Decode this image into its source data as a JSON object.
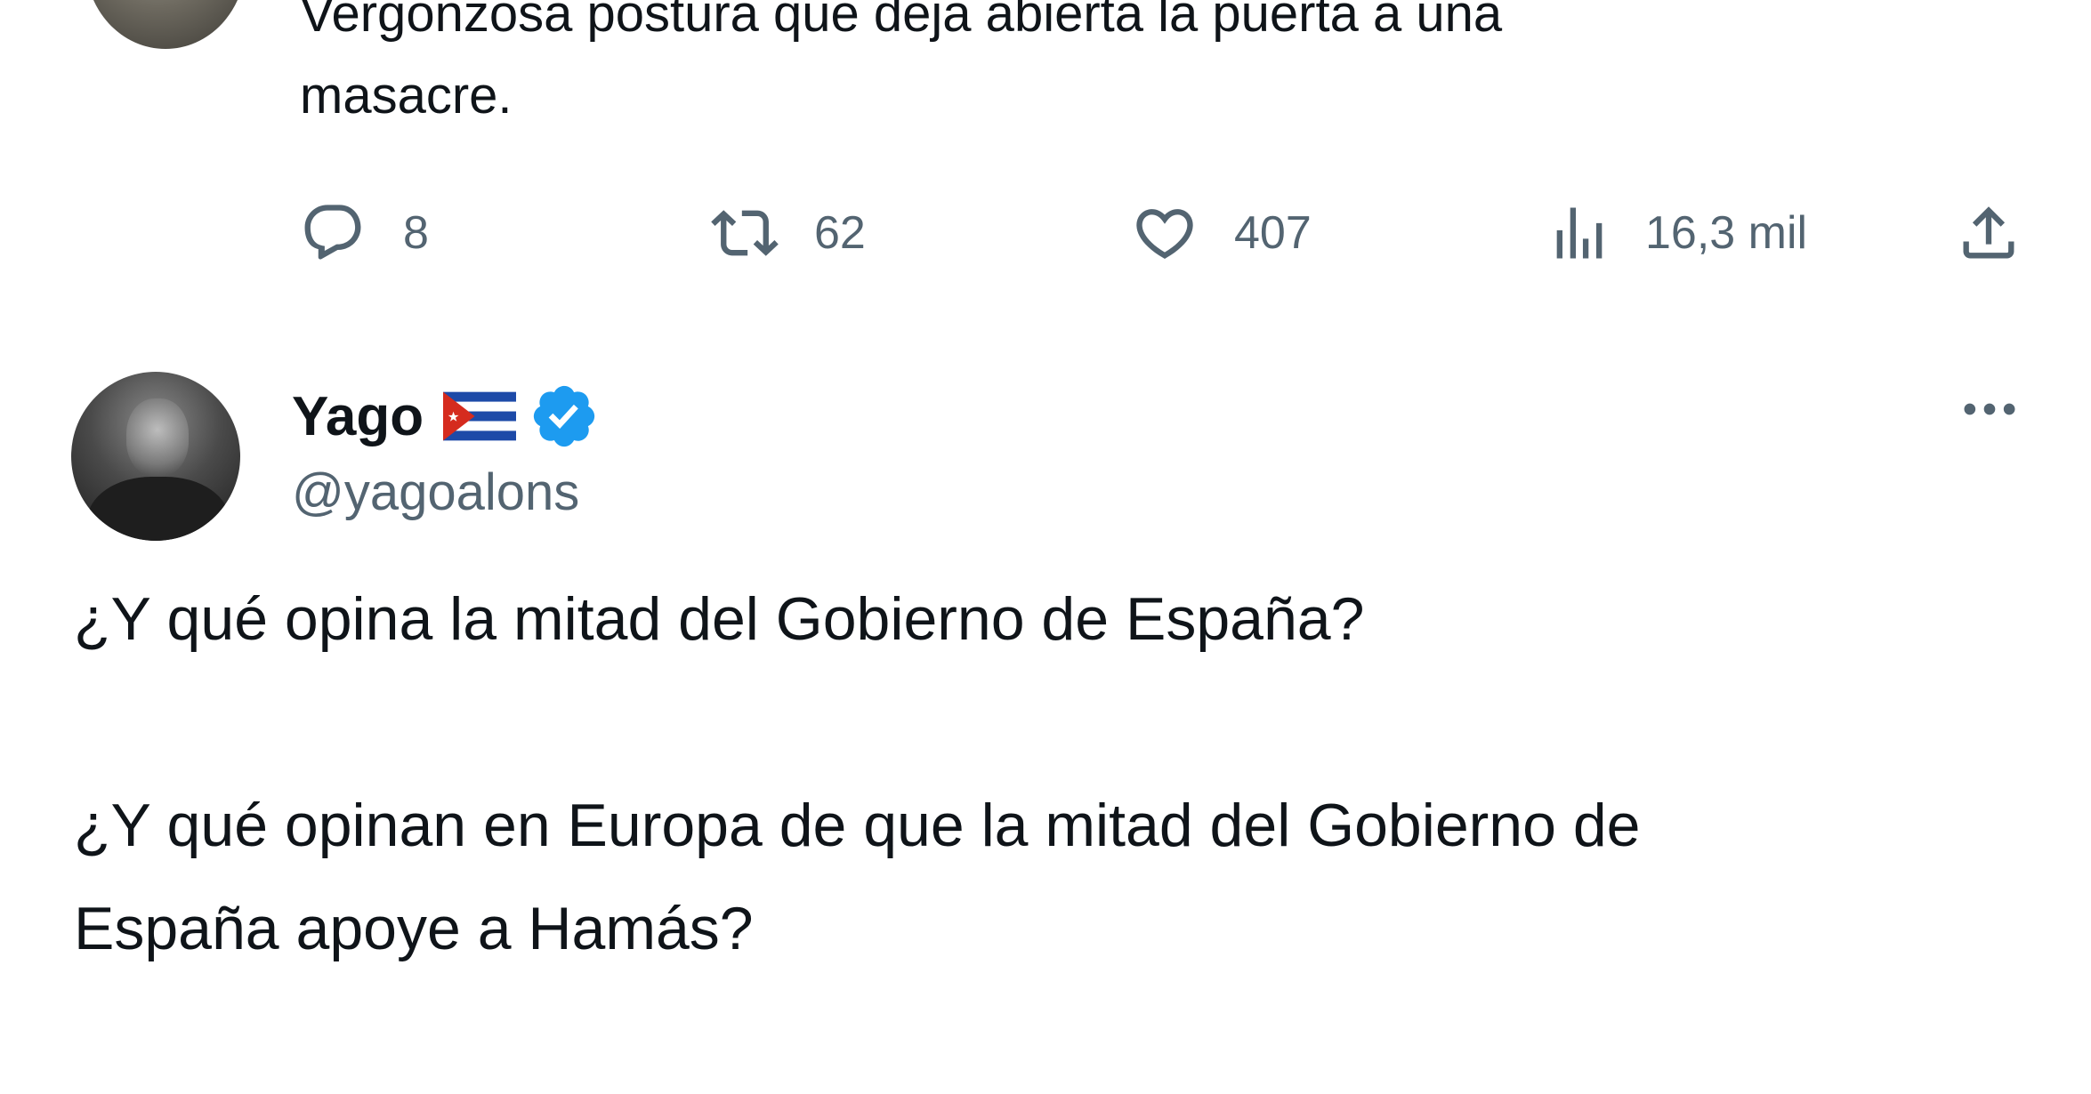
{
  "previous_tweet": {
    "text_line_1": "Vergonzosa postura que deja abierta la puerta a una",
    "text_line_2": "masacre.",
    "actions": {
      "replies": "8",
      "retweets": "62",
      "likes": "407",
      "views": "16,3 mil"
    },
    "icons": [
      "reply-icon",
      "retweet-icon",
      "like-icon",
      "views-icon",
      "share-icon"
    ]
  },
  "tweet": {
    "display_name": "Yago",
    "flag": "cuba-flag-emoji",
    "verified": true,
    "handle": "@yagoalons",
    "more_icon": "more-options-icon",
    "paragraphs": [
      "¿Y qué opina la mitad del Gobierno de España?",
      "¿Y qué opinan en Europa de que la mitad del Gobierno de",
      "España apoye a Hamás?"
    ]
  },
  "colors": {
    "text": "#0f1419",
    "secondary": "#536471",
    "verified_blue": "#1d9bf0"
  }
}
